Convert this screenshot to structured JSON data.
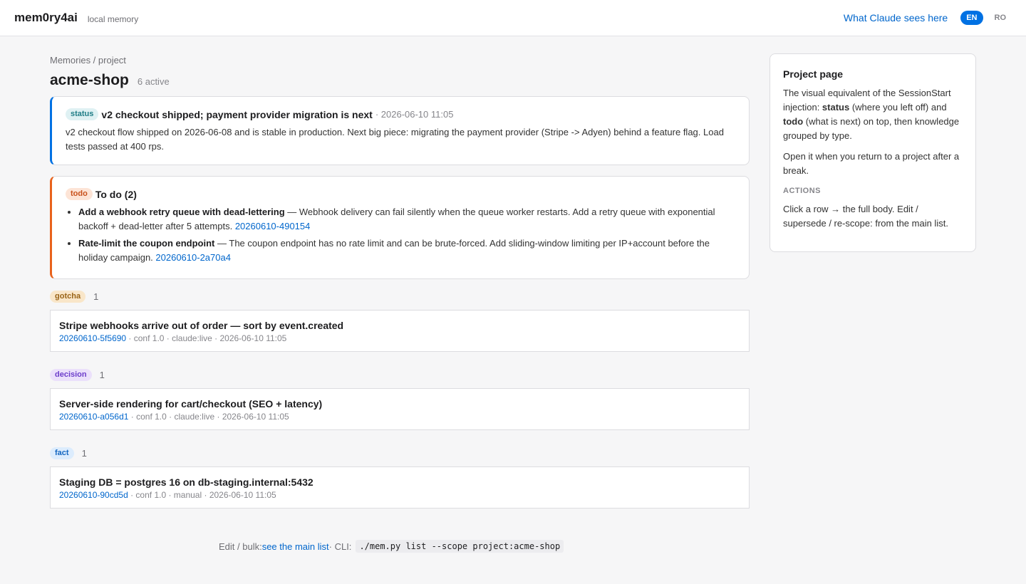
{
  "app": {
    "name": "mem0ry4ai",
    "subtitle": "local memory"
  },
  "nav": {
    "claude_link": "What Claude sees here",
    "lang_active": "EN",
    "lang_other": "RO"
  },
  "breadcrumb": "Memories / project",
  "page": {
    "title": "acme-shop",
    "active_count": "6 active"
  },
  "status_card": {
    "tag": "status",
    "title": "v2 checkout shipped; payment provider migration is next",
    "date": "· 2026-06-10 11:05",
    "body": "v2 checkout flow shipped on 2026-06-08 and is stable in production. Next big piece: migrating the payment provider (Stripe -> Adyen) behind a feature flag. Load tests passed at 400 rps."
  },
  "todo_card": {
    "tag": "todo",
    "title": "To do (2)",
    "items": [
      {
        "title": "Add a webhook retry queue with dead-lettering",
        "text": " — Webhook delivery can fail silently when the queue worker restarts. Add a retry queue with exponential backoff + dead-letter after 5 attempts. ",
        "id": "20260610-490154"
      },
      {
        "title": "Rate-limit the coupon endpoint",
        "text": " — The coupon endpoint has no rate limit and can be brute-forced. Add sliding-window limiting per IP+account before the holiday campaign. ",
        "id": "20260610-2a70a4"
      }
    ]
  },
  "sections": {
    "gotcha": {
      "tag": "gotcha",
      "count": "1",
      "row": {
        "title": "Stripe webhooks arrive out of order — sort by event.created",
        "id": "20260610-5f5690",
        "meta": " · conf 1.0 · claude:live · 2026-06-10 11:05"
      }
    },
    "decision": {
      "tag": "decision",
      "count": "1",
      "row": {
        "title": "Server-side rendering for cart/checkout (SEO + latency)",
        "id": "20260610-a056d1",
        "meta": " · conf 1.0 · claude:live · 2026-06-10 11:05"
      }
    },
    "fact": {
      "tag": "fact",
      "count": "1",
      "row": {
        "title": "Staging DB = postgres 16 on db-staging.internal:5432",
        "id": "20260610-90cd5d",
        "meta": " · conf 1.0 · manual · 2026-06-10 11:05"
      }
    }
  },
  "sidebar": {
    "title": "Project page",
    "p1_a": "The visual equivalent of the SessionStart injection: ",
    "p1_status": "status",
    "p1_b": " (where you left off) and ",
    "p1_todo": "todo",
    "p1_c": " (what is next) on top, then knowledge grouped by type.",
    "p2": "Open it when you return to a project after a break.",
    "actions_heading": "ACTIONS",
    "actions_text": "Click a row → the full body. Edit / supersede / re-scope: from the main list."
  },
  "footer": {
    "prefix": "Edit / bulk: ",
    "link": "see the main list",
    "cli_label": " · CLI: ",
    "command": "./mem.py list --scope project:acme-shop"
  }
}
